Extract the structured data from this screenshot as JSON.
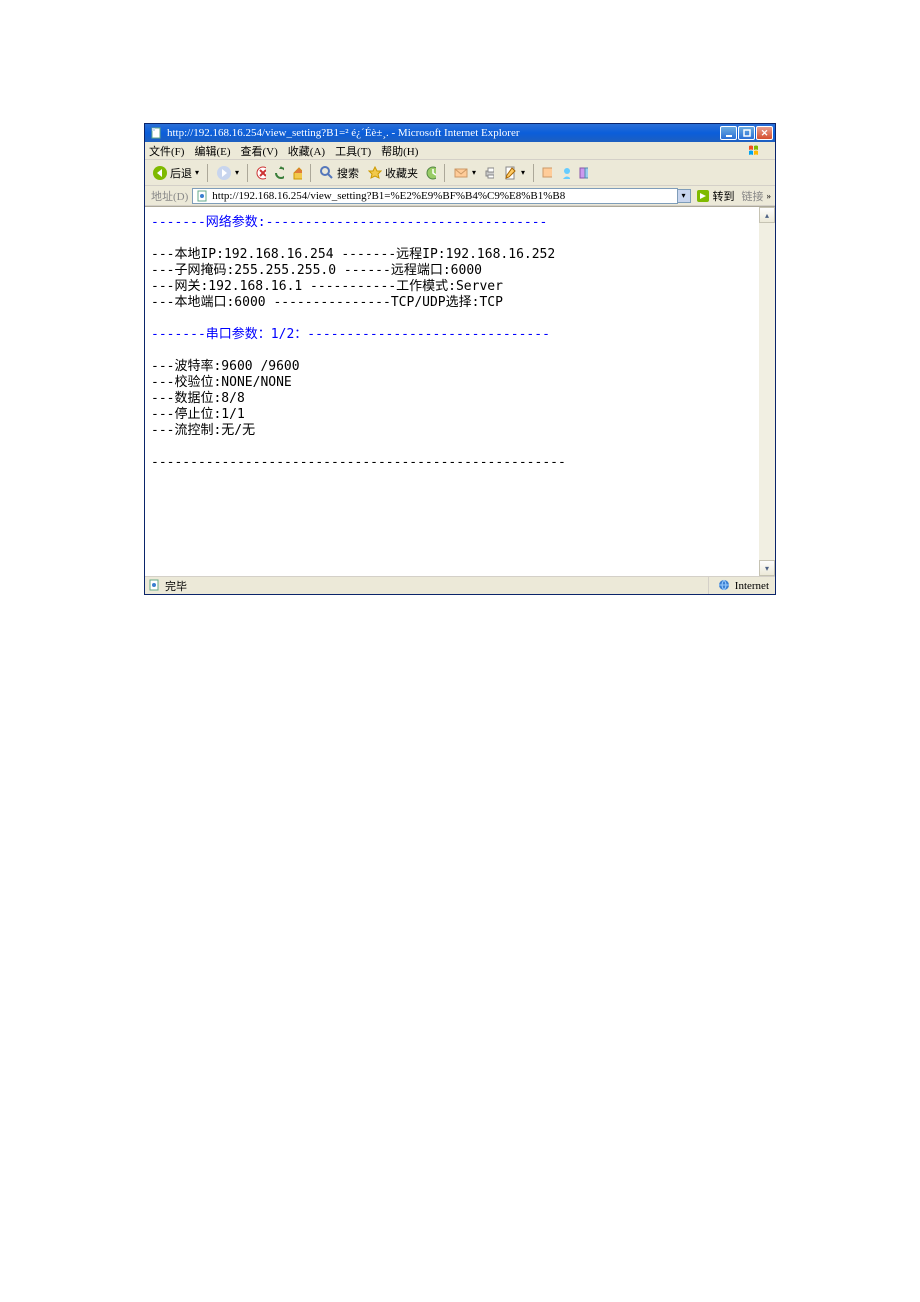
{
  "window": {
    "title": "http://192.168.16.254/view_setting?B1=² é¿´Éè±¸. - Microsoft Internet Explorer"
  },
  "menu": {
    "file": "文件(F)",
    "edit": "编辑(E)",
    "view": "查看(V)",
    "favorites": "收藏(A)",
    "tools": "工具(T)",
    "help": "帮助(H)"
  },
  "toolbar": {
    "back": "后退",
    "search": "搜索",
    "favorites": "收藏夹"
  },
  "address": {
    "label": "地址(D)",
    "url": "http://192.168.16.254/view_setting?B1=%E2%E9%BF%B4%C9%E8%B1%B8",
    "go": "转到",
    "links": "链接"
  },
  "page": {
    "net_header": "-------网络参数:------------------------------------",
    "l1": "---本地IP:192.168.16.254 -------远程IP:192.168.16.252",
    "l2": "---子网掩码:255.255.255.0 ------远程端口:6000",
    "l3": "---网关:192.168.16.1 -----------工作模式:Server",
    "l4": "---本地端口:6000 ---------------TCP/UDP选择:TCP",
    "ser_header": "-------串口参数：1/2：-------------------------------",
    "s1": "---波特率:9600 /9600",
    "s2": "---校验位:NONE/NONE",
    "s3": "---数据位:8/8",
    "s4": "---停止位:1/1",
    "s5": "---流控制:无/无",
    "footer": "-----------------------------------------------------"
  },
  "status": {
    "done": "完毕",
    "zone": "Internet"
  }
}
